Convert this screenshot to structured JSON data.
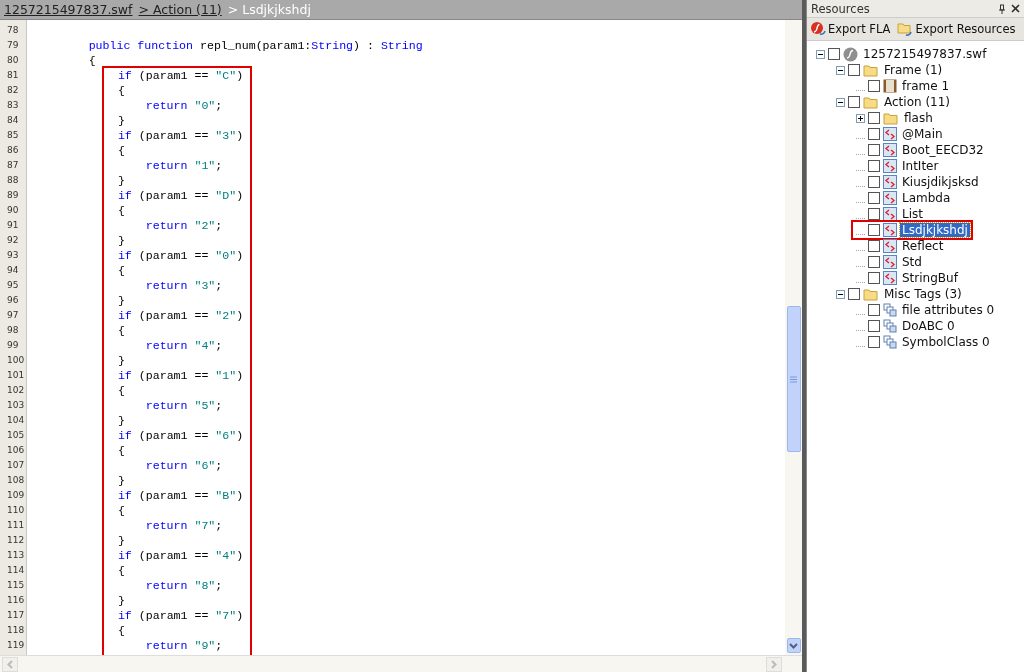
{
  "breadcrumb": [
    {
      "label": "1257215497837.swf",
      "kind": "link"
    },
    {
      "label": "> Action (11)",
      "kind": "link"
    },
    {
      "label": "> Lsdjkjkshdj",
      "kind": "current"
    }
  ],
  "code": {
    "lines": [
      {
        "number": "78"
      },
      {
        "number": "79",
        "tokens": [
          {
            "kind": "keyword",
            "text": "        public"
          },
          {
            "kind": "keyword",
            "text": " function"
          },
          {
            "kind": "plain",
            "text": " repl_num(param1:"
          },
          {
            "kind": "type",
            "text": "String"
          },
          {
            "kind": "plain",
            "text": ") : "
          },
          {
            "kind": "type",
            "text": "String"
          }
        ]
      },
      {
        "number": "80",
        "tokens": [
          {
            "kind": "plain",
            "text": "        {"
          }
        ]
      }
    ],
    "boxed_lines": [
      {
        "number": "81",
        "tokens": [
          {
            "kind": "keyword",
            "text": "  if"
          },
          {
            "kind": "plain",
            "text": " (param1 == "
          },
          {
            "kind": "string",
            "text": "\"C\""
          },
          {
            "kind": "plain",
            "text": ")"
          }
        ]
      },
      {
        "number": "82",
        "tokens": [
          {
            "kind": "plain",
            "text": "  {"
          }
        ]
      },
      {
        "number": "83",
        "tokens": [
          {
            "kind": "keyword",
            "text": "      return"
          },
          {
            "kind": "string",
            "text": " \"0\""
          },
          {
            "kind": "plain",
            "text": ";"
          }
        ]
      },
      {
        "number": "84",
        "tokens": [
          {
            "kind": "plain",
            "text": "  }"
          }
        ]
      },
      {
        "number": "85",
        "tokens": [
          {
            "kind": "keyword",
            "text": "  if"
          },
          {
            "kind": "plain",
            "text": " (param1 == "
          },
          {
            "kind": "string",
            "text": "\"3\""
          },
          {
            "kind": "plain",
            "text": ")"
          }
        ]
      },
      {
        "number": "86",
        "tokens": [
          {
            "kind": "plain",
            "text": "  {"
          }
        ]
      },
      {
        "number": "87",
        "tokens": [
          {
            "kind": "keyword",
            "text": "      return"
          },
          {
            "kind": "string",
            "text": " \"1\""
          },
          {
            "kind": "plain",
            "text": ";"
          }
        ]
      },
      {
        "number": "88",
        "tokens": [
          {
            "kind": "plain",
            "text": "  }"
          }
        ]
      },
      {
        "number": "89",
        "tokens": [
          {
            "kind": "keyword",
            "text": "  if"
          },
          {
            "kind": "plain",
            "text": " (param1 == "
          },
          {
            "kind": "string",
            "text": "\"D\""
          },
          {
            "kind": "plain",
            "text": ")"
          }
        ]
      },
      {
        "number": "90",
        "tokens": [
          {
            "kind": "plain",
            "text": "  {"
          }
        ]
      },
      {
        "number": "91",
        "tokens": [
          {
            "kind": "keyword",
            "text": "      return"
          },
          {
            "kind": "string",
            "text": " \"2\""
          },
          {
            "kind": "plain",
            "text": ";"
          }
        ]
      },
      {
        "number": "92",
        "tokens": [
          {
            "kind": "plain",
            "text": "  }"
          }
        ]
      },
      {
        "number": "93",
        "tokens": [
          {
            "kind": "keyword",
            "text": "  if"
          },
          {
            "kind": "plain",
            "text": " (param1 == "
          },
          {
            "kind": "string",
            "text": "\"0\""
          },
          {
            "kind": "plain",
            "text": ")"
          }
        ]
      },
      {
        "number": "94",
        "tokens": [
          {
            "kind": "plain",
            "text": "  {"
          }
        ]
      },
      {
        "number": "95",
        "tokens": [
          {
            "kind": "keyword",
            "text": "      return"
          },
          {
            "kind": "string",
            "text": " \"3\""
          },
          {
            "kind": "plain",
            "text": ";"
          }
        ]
      },
      {
        "number": "96",
        "tokens": [
          {
            "kind": "plain",
            "text": "  }"
          }
        ]
      },
      {
        "number": "97",
        "tokens": [
          {
            "kind": "keyword",
            "text": "  if"
          },
          {
            "kind": "plain",
            "text": " (param1 == "
          },
          {
            "kind": "string",
            "text": "\"2\""
          },
          {
            "kind": "plain",
            "text": ")"
          }
        ]
      },
      {
        "number": "98",
        "tokens": [
          {
            "kind": "plain",
            "text": "  {"
          }
        ]
      },
      {
        "number": "99",
        "tokens": [
          {
            "kind": "keyword",
            "text": "      return"
          },
          {
            "kind": "string",
            "text": " \"4\""
          },
          {
            "kind": "plain",
            "text": ";"
          }
        ]
      },
      {
        "number": "100",
        "tokens": [
          {
            "kind": "plain",
            "text": "  }"
          }
        ]
      },
      {
        "number": "101",
        "tokens": [
          {
            "kind": "keyword",
            "text": "  if"
          },
          {
            "kind": "plain",
            "text": " (param1 == "
          },
          {
            "kind": "string",
            "text": "\"1\""
          },
          {
            "kind": "plain",
            "text": ")"
          }
        ]
      },
      {
        "number": "102",
        "tokens": [
          {
            "kind": "plain",
            "text": "  {"
          }
        ]
      },
      {
        "number": "103",
        "tokens": [
          {
            "kind": "keyword",
            "text": "      return"
          },
          {
            "kind": "string",
            "text": " \"5\""
          },
          {
            "kind": "plain",
            "text": ";"
          }
        ]
      },
      {
        "number": "104",
        "tokens": [
          {
            "kind": "plain",
            "text": "  }"
          }
        ]
      },
      {
        "number": "105",
        "tokens": [
          {
            "kind": "keyword",
            "text": "  if"
          },
          {
            "kind": "plain",
            "text": " (param1 == "
          },
          {
            "kind": "string",
            "text": "\"6\""
          },
          {
            "kind": "plain",
            "text": ")"
          }
        ]
      },
      {
        "number": "106",
        "tokens": [
          {
            "kind": "plain",
            "text": "  {"
          }
        ]
      },
      {
        "number": "107",
        "tokens": [
          {
            "kind": "keyword",
            "text": "      return"
          },
          {
            "kind": "string",
            "text": " \"6\""
          },
          {
            "kind": "plain",
            "text": ";"
          }
        ]
      },
      {
        "number": "108",
        "tokens": [
          {
            "kind": "plain",
            "text": "  }"
          }
        ]
      },
      {
        "number": "109",
        "tokens": [
          {
            "kind": "keyword",
            "text": "  if"
          },
          {
            "kind": "plain",
            "text": " (param1 == "
          },
          {
            "kind": "string",
            "text": "\"B\""
          },
          {
            "kind": "plain",
            "text": ")"
          }
        ]
      },
      {
        "number": "110",
        "tokens": [
          {
            "kind": "plain",
            "text": "  {"
          }
        ]
      },
      {
        "number": "111",
        "tokens": [
          {
            "kind": "keyword",
            "text": "      return"
          },
          {
            "kind": "string",
            "text": " \"7\""
          },
          {
            "kind": "plain",
            "text": ";"
          }
        ]
      },
      {
        "number": "112",
        "tokens": [
          {
            "kind": "plain",
            "text": "  }"
          }
        ]
      },
      {
        "number": "113",
        "tokens": [
          {
            "kind": "keyword",
            "text": "  if"
          },
          {
            "kind": "plain",
            "text": " (param1 == "
          },
          {
            "kind": "string",
            "text": "\"4\""
          },
          {
            "kind": "plain",
            "text": ")"
          }
        ]
      },
      {
        "number": "114",
        "tokens": [
          {
            "kind": "plain",
            "text": "  {"
          }
        ]
      },
      {
        "number": "115",
        "tokens": [
          {
            "kind": "keyword",
            "text": "      return"
          },
          {
            "kind": "string",
            "text": " \"8\""
          },
          {
            "kind": "plain",
            "text": ";"
          }
        ]
      },
      {
        "number": "116",
        "tokens": [
          {
            "kind": "plain",
            "text": "  }"
          }
        ]
      },
      {
        "number": "117",
        "tokens": [
          {
            "kind": "keyword",
            "text": "  if"
          },
          {
            "kind": "plain",
            "text": " (param1 == "
          },
          {
            "kind": "string",
            "text": "\"7\""
          },
          {
            "kind": "plain",
            "text": ")"
          }
        ]
      },
      {
        "number": "118",
        "tokens": [
          {
            "kind": "plain",
            "text": "  {"
          }
        ]
      },
      {
        "number": "119",
        "tokens": [
          {
            "kind": "keyword",
            "text": "      return"
          },
          {
            "kind": "string",
            "text": " \"9\""
          },
          {
            "kind": "plain",
            "text": ";"
          }
        ]
      }
    ]
  },
  "panel": {
    "title": "Resources",
    "toolbar": [
      {
        "label": "Export FLA",
        "kind": "fla"
      },
      {
        "label": "Export Resources",
        "kind": "resources"
      }
    ],
    "tree": [
      {
        "label": "1257215497837.swf",
        "kind": "swf",
        "expanded": true,
        "checked": false,
        "selected": false,
        "annotated": false,
        "children": [
          {
            "label": "Frame (1)",
            "kind": "folder",
            "expanded": true,
            "checked": false,
            "selected": false,
            "annotated": false,
            "children": [
              {
                "label": "frame 1",
                "kind": "frame",
                "checked": false,
                "selected": false,
                "annotated": false
              }
            ]
          },
          {
            "label": "Action (11)",
            "kind": "folder",
            "expanded": true,
            "checked": false,
            "selected": false,
            "annotated": false,
            "children": [
              {
                "label": "flash",
                "kind": "folder",
                "expanded": false,
                "checked": false,
                "selected": false,
                "annotated": false
              },
              {
                "label": "@Main",
                "kind": "script",
                "checked": false,
                "selected": false,
                "annotated": false
              },
              {
                "label": "Boot_EECD32",
                "kind": "script",
                "checked": false,
                "selected": false,
                "annotated": false
              },
              {
                "label": "IntIter",
                "kind": "script",
                "checked": false,
                "selected": false,
                "annotated": false
              },
              {
                "label": "Kiusjdikjsksd",
                "kind": "script",
                "checked": false,
                "selected": false,
                "annotated": false
              },
              {
                "label": "Lambda",
                "kind": "script",
                "checked": false,
                "selected": false,
                "annotated": false
              },
              {
                "label": "List",
                "kind": "script",
                "checked": false,
                "selected": false,
                "annotated": false
              },
              {
                "label": "Lsdjkjkshdj",
                "kind": "script",
                "checked": false,
                "selected": true,
                "annotated": true
              },
              {
                "label": "Reflect",
                "kind": "script",
                "checked": false,
                "selected": false,
                "annotated": false
              },
              {
                "label": "Std",
                "kind": "script",
                "checked": false,
                "selected": false,
                "annotated": false
              },
              {
                "label": "StringBuf",
                "kind": "script",
                "checked": false,
                "selected": false,
                "annotated": false
              }
            ]
          },
          {
            "label": "Misc Tags (3)",
            "kind": "folder",
            "expanded": true,
            "checked": false,
            "selected": false,
            "annotated": false,
            "children": [
              {
                "label": "file attributes 0",
                "kind": "tag",
                "checked": false,
                "selected": false,
                "annotated": false
              },
              {
                "label": "DoABC 0",
                "kind": "tag",
                "checked": false,
                "selected": false,
                "annotated": false
              },
              {
                "label": "SymbolClass 0",
                "kind": "tag",
                "checked": false,
                "selected": false,
                "annotated": false
              }
            ]
          }
        ]
      }
    ]
  }
}
